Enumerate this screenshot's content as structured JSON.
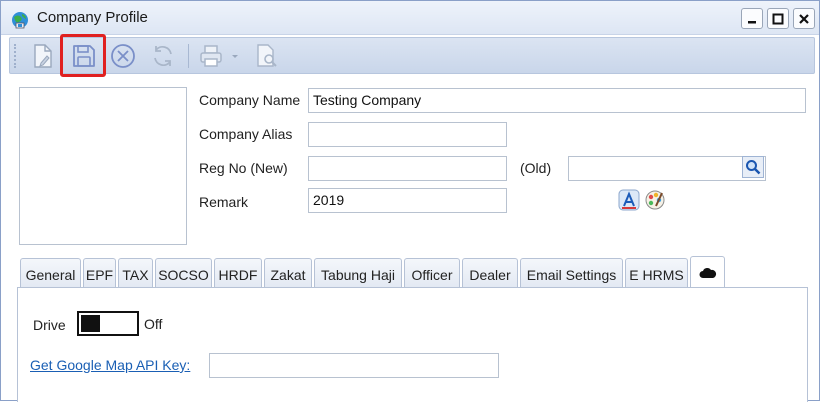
{
  "window": {
    "title": "Company Profile"
  },
  "toolbar": {
    "buttons": [
      "new-document-icon",
      "save-icon",
      "cancel-icon",
      "refresh-icon",
      "print-icon",
      "preview-icon"
    ]
  },
  "form": {
    "company_name_label": "Company Name",
    "company_name_value": "Testing Company",
    "company_alias_label": "Company Alias",
    "company_alias_value": "",
    "reg_no_new_label": "Reg No (New)",
    "reg_no_new_value": "",
    "reg_no_old_label": "(Old)",
    "reg_no_old_value": "",
    "remark_label": "Remark",
    "remark_value": "2019"
  },
  "tabs": [
    {
      "label": "General"
    },
    {
      "label": "EPF"
    },
    {
      "label": "TAX"
    },
    {
      "label": "SOCSO"
    },
    {
      "label": "HRDF"
    },
    {
      "label": "Zakat"
    },
    {
      "label": "Tabung Haji"
    },
    {
      "label": "Officer"
    },
    {
      "label": "Dealer"
    },
    {
      "label": "Email Settings"
    },
    {
      "label": "E HRMS"
    },
    {
      "label": "",
      "icon": "cloud-icon",
      "active": true
    }
  ],
  "drive": {
    "label": "Drive",
    "state": "Off"
  },
  "map": {
    "link_text": "Get Google Map API Key:",
    "value": ""
  }
}
